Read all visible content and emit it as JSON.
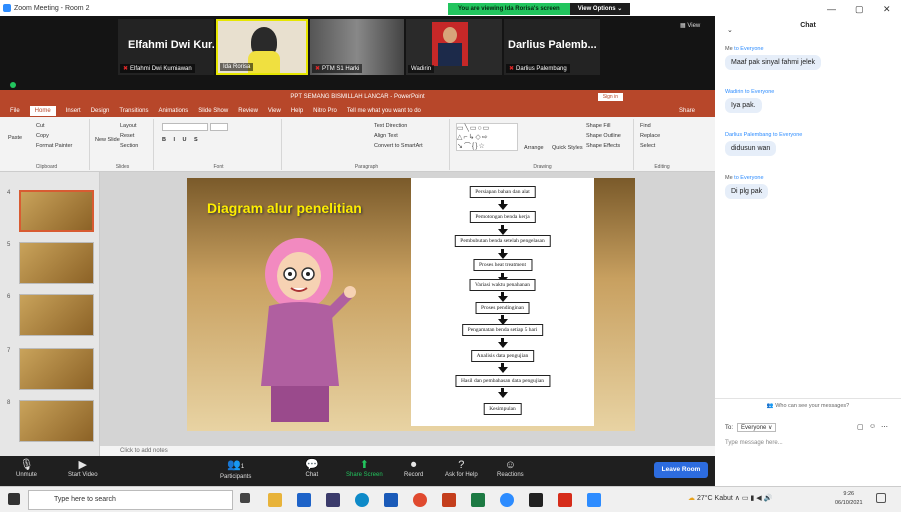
{
  "window": {
    "title": "Zoom Meeting - Room 2",
    "share_status": "You are viewing Ida Rorisa's screen",
    "view_options": "View Options ⌄",
    "view_button": "View"
  },
  "participants": [
    {
      "name": "Elfahmi Dwi Kur...",
      "label": "Elfahmi Dwi Kurniawan"
    },
    {
      "name": "",
      "label": "Ida Rorisa"
    },
    {
      "name": "",
      "label": "PTM S1 Harki"
    },
    {
      "name": "",
      "label": "Wadirin"
    },
    {
      "name": "Darlius Palemb...",
      "label": "Darlius Palembang"
    }
  ],
  "ppt": {
    "title": "PPT SEMANG BISMILLAH LANCAR - PowerPoint",
    "signin": "Sign in",
    "tabs": [
      "File",
      "Home",
      "Insert",
      "Design",
      "Transitions",
      "Animations",
      "Slide Show",
      "Review",
      "View",
      "Help",
      "Nitro Pro",
      "Tell me what you want to do",
      "Share"
    ],
    "ribbon": {
      "paste": "Paste",
      "cut": "Cut",
      "copy": "Copy",
      "format_painter": "Format Painter",
      "clipboard": "Clipboard",
      "new_slide": "New Slide",
      "layout": "Layout",
      "reset": "Reset",
      "section": "Section",
      "slides": "Slides",
      "font": "Font",
      "paragraph": "Paragraph",
      "text_direction": "Text Direction",
      "align_text": "Align Text",
      "convert_smartart": "Convert to SmartArt",
      "drawing": "Drawing",
      "arrange": "Arrange",
      "quick_styles": "Quick Styles",
      "shape_fill": "Shape Fill",
      "shape_outline": "Shape Outline",
      "shape_effects": "Shape Effects",
      "find": "Find",
      "replace": "Replace",
      "select": "Select",
      "editing": "Editing"
    },
    "thumb_numbers": [
      "4",
      "5",
      "6",
      "7",
      "8"
    ],
    "slide_title": "Diagram alur penelitian",
    "flow_steps": [
      "Persiapan bahan dan alat",
      "Pemotongan benda kerja",
      "Pembubutan benda setelah pengelasan",
      "Proses heat treatment",
      "Variasi waktu penahanan",
      "Proses pendinginan",
      "Pengamatan benda setiap 5 hari",
      "Analisis data pengujian",
      "Hasil dan pembahasan data pengujian",
      "Kesimpulan"
    ],
    "notes": "Click to add notes"
  },
  "controls": {
    "unmute": "Unmute",
    "start_video": "Start Video",
    "participants": "Participants",
    "participants_count": "1",
    "chat": "Chat",
    "share_screen": "Share Screen",
    "record": "Record",
    "ask_help": "Ask for Help",
    "reactions": "Reactions",
    "leave": "Leave Room"
  },
  "chat": {
    "header": "Chat",
    "messages": [
      {
        "from": "Me",
        "to": "Everyone",
        "text": "Maaf pak sinyal fahmi jelek"
      },
      {
        "from": "Wadirin",
        "to": "Everyone",
        "text": "Iya pak."
      },
      {
        "from": "Darlius Palembang",
        "to": "Everyone",
        "text": "didusun wan"
      },
      {
        "from": "Me",
        "to": "Everyone",
        "text": "Di plg pak"
      }
    ],
    "who_can_see": "Who can see your messages?",
    "to_label": "To:",
    "to_value": "Everyone ∨",
    "placeholder": "Type message here..."
  },
  "taskbar": {
    "search": "Type here to search",
    "weather": "27°C Kabut",
    "time": "9:26",
    "date": "06/10/2021"
  }
}
